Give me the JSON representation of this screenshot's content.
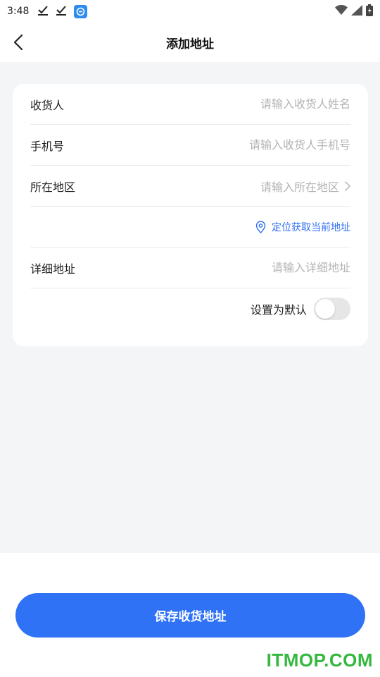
{
  "status_bar": {
    "time": "3:48",
    "icons": [
      "download-done-icon",
      "download-done-icon",
      "app-notification-icon",
      "wifi-icon",
      "signal-icon",
      "battery-charging-icon"
    ]
  },
  "header": {
    "title": "添加地址",
    "back_icon": "chevron-left-icon"
  },
  "form": {
    "recipient": {
      "label": "收货人",
      "placeholder": "请输入收货人姓名"
    },
    "phone": {
      "label": "手机号",
      "placeholder": "请输入收货人手机号"
    },
    "region": {
      "label": "所在地区",
      "placeholder": "请输入所在地区"
    },
    "locate": {
      "label": "定位获取当前地址"
    },
    "detail": {
      "label": "详细地址",
      "placeholder": "请输入详细地址"
    },
    "default": {
      "label": "设置为默认",
      "checked": false
    }
  },
  "actions": {
    "save_label": "保存收货地址"
  },
  "watermark": "ITMOP.COM",
  "colors": {
    "accent": "#2f72f6",
    "link": "#2f6ff5",
    "background": "#f4f5f7",
    "watermark": "#35b83f"
  }
}
